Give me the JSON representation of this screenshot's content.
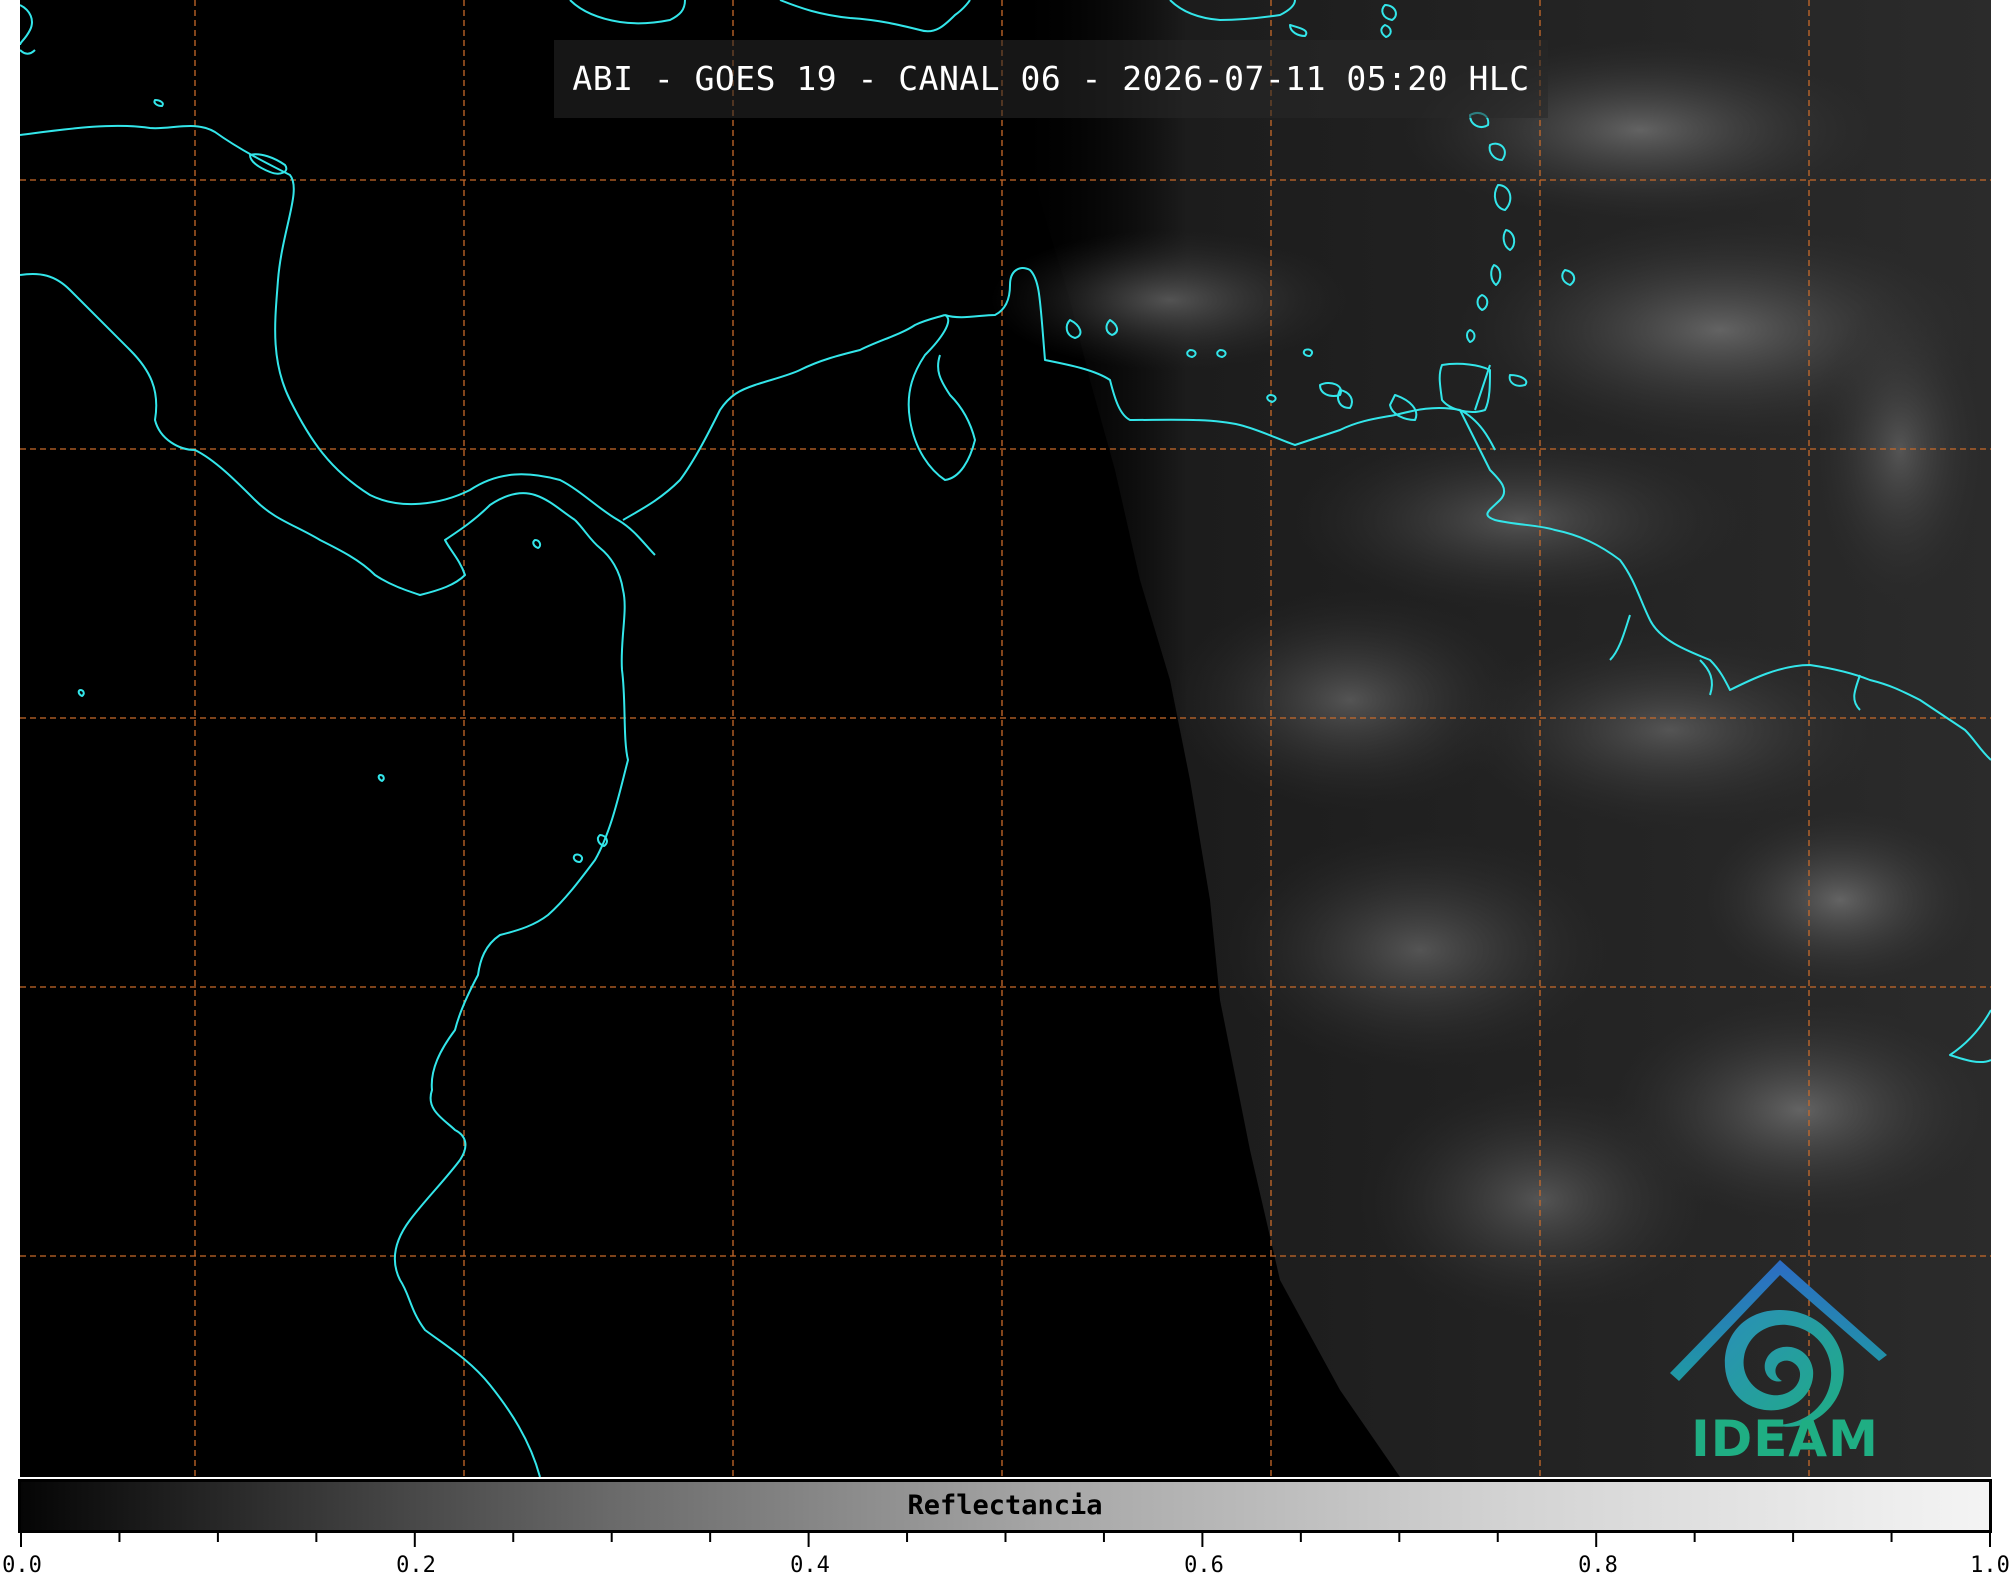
{
  "title": "ABI - GOES 19 - CANAL 06 - 2026-07-11 05:20 HLC",
  "colorbar": {
    "label": "Reflectancia",
    "ticks": [
      "0.0",
      "0.2",
      "0.4",
      "0.6",
      "0.8",
      "1.0"
    ],
    "range": [
      0.0,
      1.0
    ],
    "colormap": "grayscale"
  },
  "logo": {
    "text": "IDEAM",
    "color": "#1fae83"
  },
  "colors": {
    "coastline": "#33e6ea",
    "gridline": "#c86a2a",
    "background": "#000000"
  },
  "map": {
    "grid": "dashed",
    "content": "satellite reflectance imagery with coastlines"
  }
}
